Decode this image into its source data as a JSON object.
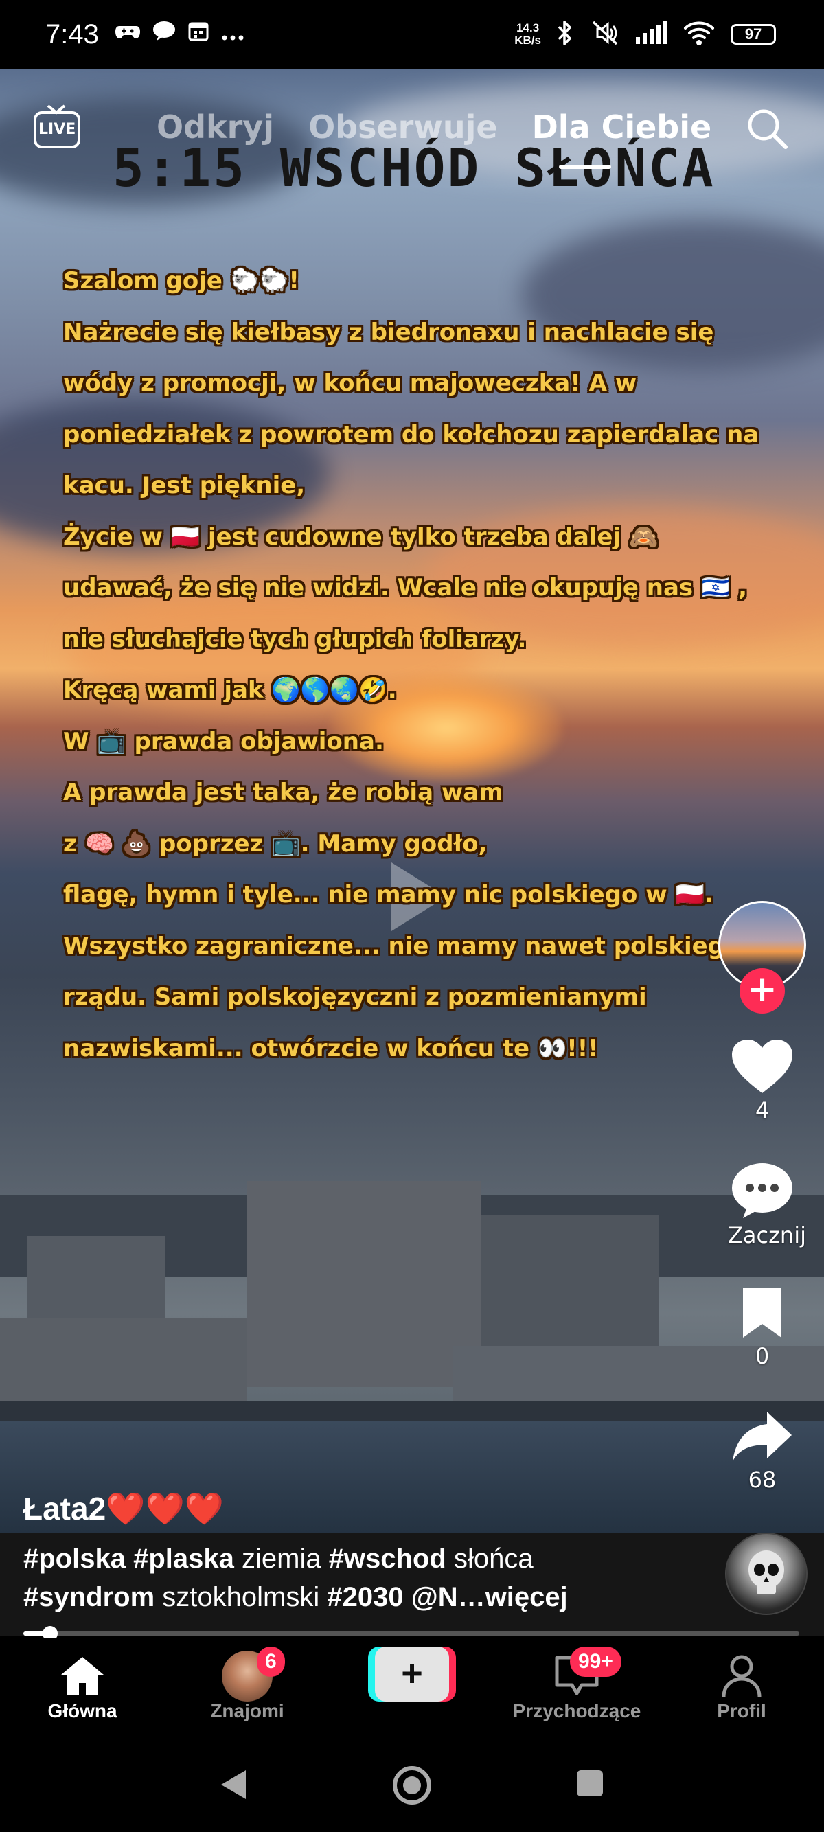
{
  "status_bar": {
    "time": "7:43",
    "left_icons": [
      "game-controller-icon",
      "chat-bubble-icon",
      "calendar-icon",
      "more-dots-icon"
    ],
    "network_speed_value": "14.3",
    "network_speed_unit": "KB/s",
    "battery": "97",
    "right_icons": [
      "bluetooth-icon",
      "muted-icon",
      "signal-icon",
      "wifi-icon",
      "battery-icon"
    ]
  },
  "top_nav": {
    "live_label": "LIVE",
    "tabs": [
      {
        "label": "Odkryj",
        "active": false
      },
      {
        "label": "Obserwuje",
        "active": false
      },
      {
        "label": "Dla Ciebie",
        "active": true
      }
    ]
  },
  "video": {
    "headline": "5:15 WSCHÓD SŁOŃCA",
    "overlay_lines": [
      "Szalom goje 🐑🐑!",
      "Nażrecie się kiełbasy z biedronaxu i nachlacie się",
      "wódy z promocji, w końcu majoweczka! A w",
      "poniedziałek z powrotem do kołchozu zapierdalac na",
      "kacu. Jest pięknie,",
      "Życie w 🇵🇱 jest cudowne tylko trzeba dalej 🙈",
      "udawać, że się nie widzi. Wcale nie okupuję nas 🇮🇱 ,",
      "nie słuchajcie tych głupich foliarzy.",
      "Kręcą wami jak 🌍🌎🌏🤣.",
      "W 📺 prawda objawiona.",
      "A prawda jest taka, że robią wam",
      "z 🧠 💩 poprzez 📺. Mamy godło,",
      "flagę, hymn i tyle... nie mamy nic polskiego w 🇵🇱.",
      "Wszystko zagraniczne... nie mamy nawet polskiego",
      "rządu. Sami polskojęzyczni z pozmienianymi",
      "nazwiskami... otwórzcie w końcu te 👀!!!"
    ]
  },
  "rail": {
    "follow_label": "+",
    "likes": "4",
    "comments": "Zacznij",
    "saves": "0",
    "shares": "68"
  },
  "post": {
    "username": "Łata2",
    "username_hearts": "❤️❤️❤️",
    "caption_parts": [
      {
        "text": "#polska",
        "tag": true
      },
      {
        "text": " ",
        "tag": false
      },
      {
        "text": "#plaska",
        "tag": true
      },
      {
        "text": " ziemia ",
        "tag": false
      },
      {
        "text": "#wschod",
        "tag": true
      },
      {
        "text": " słońca",
        "tag": false
      }
    ],
    "caption_parts_line2": [
      {
        "text": "#syndrom",
        "tag": true
      },
      {
        "text": " sztokholmski ",
        "tag": false
      },
      {
        "text": "#2030",
        "tag": true
      },
      {
        "text": " ",
        "tag": false
      },
      {
        "text": "@N",
        "tag": true
      },
      {
        "text": "…więcej",
        "tag": true
      }
    ],
    "progress_fraction": 0.028
  },
  "bottom_nav": {
    "home": "Główna",
    "friends": "Znajomi",
    "friends_badge": "6",
    "create": "+",
    "inbox": "Przychodzące",
    "inbox_badge": "99+",
    "profile": "Profil"
  },
  "colors": {
    "accent": "#fe2c55",
    "create_cyan": "#25f4ee",
    "overlay_text": "#f6c94a"
  }
}
